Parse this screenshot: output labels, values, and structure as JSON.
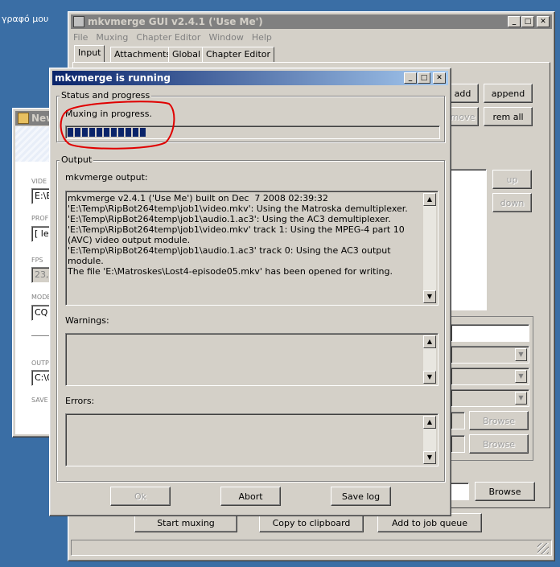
{
  "desktop": {
    "icon_label": "γραφό μου"
  },
  "bg_window": {
    "title": "New"
  },
  "mkvgui": {
    "title": "mkvmerge GUI v2.4.1 ('Use Me')",
    "menu": [
      "File",
      "Muxing",
      "Chapter Editor",
      "Window",
      "Help"
    ],
    "tabs": [
      "Input",
      "Attachments",
      "Global",
      "Chapter Editor"
    ],
    "add": "add",
    "append": "append",
    "remove": "move",
    "rem_all": "rem all",
    "up": "up",
    "down": "down",
    "browse1": "Browse",
    "browse2": "Browse",
    "browse3": "Browse",
    "start_muxing": "Start muxing",
    "copy_clipboard": "Copy to clipboard",
    "add_job_queue": "Add to job queue"
  },
  "left_panel": {
    "label_video": "VIDE",
    "value_video": "E:\\B",
    "label_profile": "PROF",
    "value_profile": "[ lev",
    "label_fps": "FPS",
    "value_fps": "23,9",
    "label_mode": "MODE",
    "value_mode": "CQ",
    "label_output": "OUTP",
    "value_output": "C:\\0",
    "label_save": "SAVE"
  },
  "dialog": {
    "title": "mkvmerge is running",
    "status_group": "Status and progress",
    "status_text": "Muxing in progress.",
    "progress": 0.21,
    "output_group": "Output",
    "output_label": "mkvmerge output:",
    "output_log": "mkvmerge v2.4.1 ('Use Me') built on Dec  7 2008 02:39:32\n'E:\\Temp\\RipBot264temp\\job1\\video.mkv': Using the Matroska demultiplexer.\n'E:\\Temp\\RipBot264temp\\job1\\audio.1.ac3': Using the AC3 demultiplexer.\n'E:\\Temp\\RipBot264temp\\job1\\video.mkv' track 1: Using the MPEG-4 part 10 (AVC) video output module.\n'E:\\Temp\\RipBot264temp\\job1\\audio.1.ac3' track 0: Using the AC3 output module.\nThe file 'E:\\Matroskes\\Lost4-episode05.mkv' has been opened for writing.",
    "warnings_label": "Warnings:",
    "errors_label": "Errors:",
    "ok": "Ok",
    "abort": "Abort",
    "save_log": "Save log"
  },
  "colors": {
    "progress_block": "#0a246a",
    "annotation": "#e00000"
  }
}
